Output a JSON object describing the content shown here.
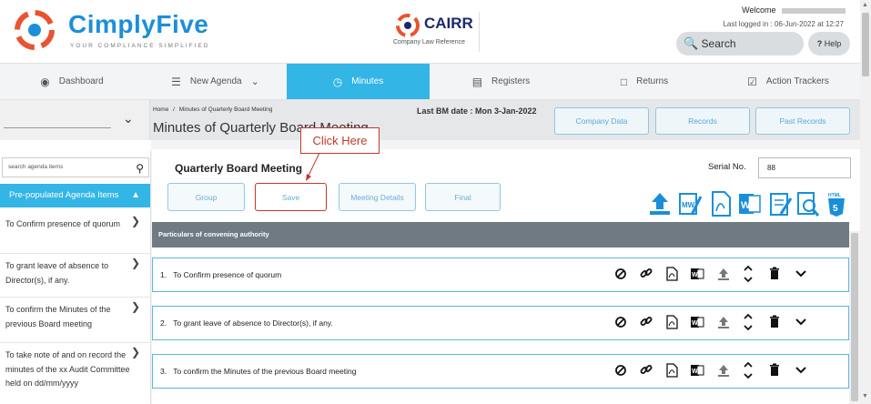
{
  "header": {
    "brand": "CimplyFive",
    "brand_tagline": "YOUR COMPLIANCE SIMPLIFIED",
    "partner_name": "CAIRR",
    "partner_subtitle": "Company Law Reference",
    "welcome": "Welcome",
    "last_logged": "Last logged in : 06-Jun-2022 at 12:27",
    "search_label": "Search",
    "help_label": "Help"
  },
  "nav": {
    "items": [
      {
        "label": "Dashboard",
        "icon": "palette-icon",
        "active": false
      },
      {
        "label": "New Agenda",
        "icon": "list-icon",
        "active": false
      },
      {
        "label": "Minutes",
        "icon": "clock-icon",
        "active": true
      },
      {
        "label": "Registers",
        "icon": "folder-icon",
        "active": false
      },
      {
        "label": "Returns",
        "icon": "document-icon",
        "active": false
      },
      {
        "label": "Action Trackers",
        "icon": "checklist-icon",
        "active": false
      }
    ]
  },
  "subheader": {
    "breadcrumb_home": "Home",
    "breadcrumb_sep": "/",
    "breadcrumb_current": "Minutes of Quarterly Board Meeting",
    "page_title": "Minutes of Quarterly Board Meeting",
    "last_bm": "Last BM date : Mon 3-Jan-2022",
    "buttons": [
      "Company Data",
      "Records",
      "Past Records"
    ]
  },
  "sidebar": {
    "search_placeholder": "search agenda items",
    "section_title": "Pre-populated Agenda Items",
    "items": [
      {
        "label": "To Confirm presence of quorum"
      },
      {
        "label": "To grant leave of absence to Director(s), if any."
      },
      {
        "label": "To confirm the Minutes of the previous Board meeting"
      },
      {
        "label": "To take note of and on record the minutes of the xx Audit Committee held on dd/mm/yyyy"
      }
    ]
  },
  "main": {
    "meeting_title": "Quarterly Board Meeting",
    "serial_label": "Serial No.",
    "serial_value": "88",
    "actions": [
      "Group",
      "Save",
      "Meeting Details",
      "Final"
    ],
    "callout": "Click Here",
    "toolbar_icons": [
      "upload-icon",
      "edit-word-icon",
      "pdf-icon",
      "word-icon",
      "notes-icon",
      "preview-icon",
      "html5-icon"
    ],
    "toolbar_html5_label": "HTML",
    "particulars_header": "Particulars of convening authority",
    "agenda_rows": [
      {
        "num": "1.",
        "text": "To Confirm presence of quorum"
      },
      {
        "num": "2.",
        "text": "To grant leave of absence to Director(s), if any."
      },
      {
        "num": "3.",
        "text": "To confirm the Minutes of the previous Board meeting"
      }
    ],
    "row_icons": [
      "block-icon",
      "link-icon",
      "pdf-icon",
      "word-icon",
      "upload-icon",
      "sort-icon",
      "delete-icon",
      "chevron-down-icon"
    ]
  },
  "colors": {
    "accent": "#33b5e5",
    "brand_blue": "#1c8fd8",
    "callout_red": "#c0392b",
    "header_gray": "#707a82"
  }
}
